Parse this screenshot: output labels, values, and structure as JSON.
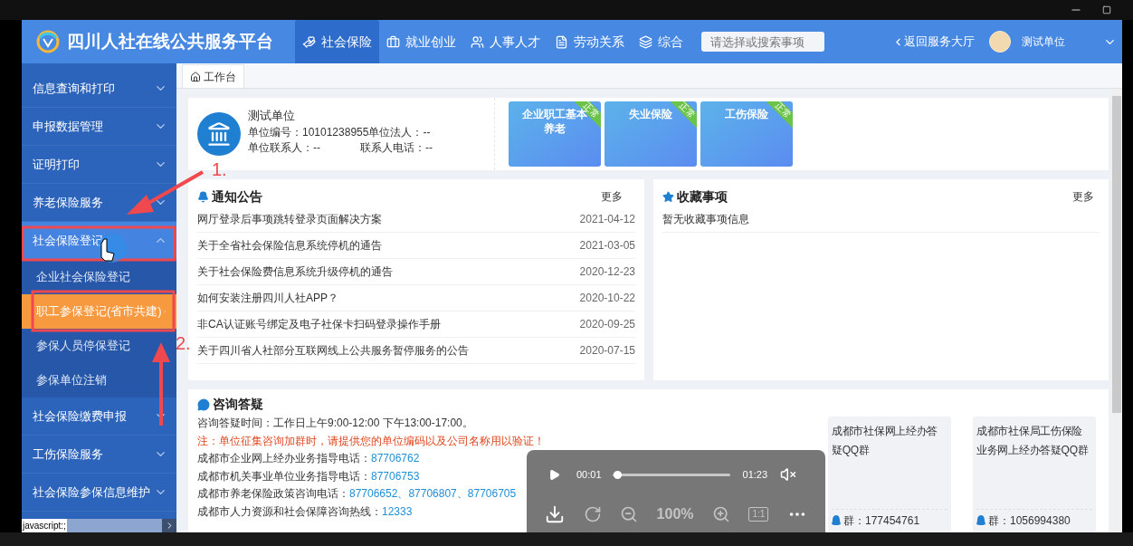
{
  "header": {
    "title": "四川人社在线公共服务平台",
    "nav": [
      {
        "label": "社会保险",
        "selected": true,
        "kind": "hands"
      },
      {
        "label": "就业创业",
        "selected": false,
        "kind": "briefcase"
      },
      {
        "label": "人事人才",
        "selected": false,
        "kind": "people"
      },
      {
        "label": "劳动关系",
        "selected": false,
        "kind": "document"
      },
      {
        "label": "综合",
        "selected": false,
        "kind": "layers"
      }
    ],
    "search": {
      "placeholder": "请选择或搜索事项"
    },
    "back_link": "返回服务大厅",
    "user": "测试单位"
  },
  "sidebar": {
    "items": [
      {
        "label": "信息查询和打印",
        "expanded": false
      },
      {
        "label": "申报数据管理",
        "expanded": false
      },
      {
        "label": "证明打印",
        "expanded": false
      },
      {
        "label": "养老保险服务",
        "expanded": false
      },
      {
        "label": "社会保险登记",
        "expanded": true,
        "children": [
          {
            "label": "企业社会保险登记",
            "selected": false
          },
          {
            "label": "职工参保登记(省市共建)",
            "selected": true
          },
          {
            "label": "参保人员停保登记",
            "selected": false
          },
          {
            "label": "参保单位注销",
            "selected": false
          }
        ]
      },
      {
        "label": "社会保险缴费申报",
        "expanded": false
      },
      {
        "label": "工伤保险服务",
        "expanded": false
      },
      {
        "label": "社会保险参保信息维护",
        "expanded": false
      }
    ]
  },
  "breadcrumb_tab": "工作台",
  "unit_card": {
    "name": "测试单位",
    "code_line": "单位编号：10101238955单位法人：--",
    "contact": "单位联系人：--",
    "phone": "联系人电话：--"
  },
  "insurance_tiles": [
    {
      "label": "企业职工基本养老",
      "status": "正常"
    },
    {
      "label": "失业保险",
      "status": "正常"
    },
    {
      "label": "工伤保险",
      "status": "正常"
    }
  ],
  "notices": {
    "title": "通知公告",
    "more": "更多",
    "rows": [
      {
        "title": "网厅登录后事项跳转登录页面解决方案",
        "date": "2021-04-12"
      },
      {
        "title": "关于全省社会保险信息系统停机的通告",
        "date": "2021-03-05"
      },
      {
        "title": "关于社会保险费信息系统升级停机的通告",
        "date": "2020-12-23"
      },
      {
        "title": "如何安装注册四川人社APP？",
        "date": "2020-10-22"
      },
      {
        "title": "非CA认证账号绑定及电子社保卡扫码登录操作手册",
        "date": "2020-09-25"
      },
      {
        "title": "关于四川省人社部分互联网线上公共服务暂停服务的公告",
        "date": "2020-07-15"
      }
    ]
  },
  "favorites": {
    "title": "收藏事项",
    "more": "更多",
    "empty": "暂无收藏事项信息"
  },
  "consult": {
    "title": "咨询答疑",
    "hours": "咨询答疑时间：工作日上午9:00-12:00 下午13:00-17:00。",
    "note": "注：单位征集咨询加群时，请提供您的单位编码以及公司名称用以验证！",
    "phones": [
      {
        "label": "成都市企业网上经办业务指导电话：",
        "number": "87706762"
      },
      {
        "label": "成都市机关事业单位业务指导电话：",
        "number": "87706753"
      },
      {
        "label": "成都市养老保险政策咨询电话：",
        "number": "87706652、87706807、87706705"
      },
      {
        "label": "成都市人力资源和社会保障咨询热线：",
        "number": "12333"
      }
    ],
    "qq_groups": [
      {
        "name": "成都市社保网上经办答疑QQ群",
        "number": "群：177454761"
      },
      {
        "name": "成都市社保局工伤保险业务网上经办答疑QQ群",
        "number": "群：1056994380"
      }
    ]
  },
  "video_player": {
    "current": "00:01",
    "level": 0.01,
    "duration": "01:23",
    "muted": true,
    "zoom": "100%",
    "ratio": "1:1"
  },
  "status_tooltip": "javascript:;",
  "annotations": [
    {
      "label": "1."
    },
    {
      "label": "2."
    }
  ]
}
